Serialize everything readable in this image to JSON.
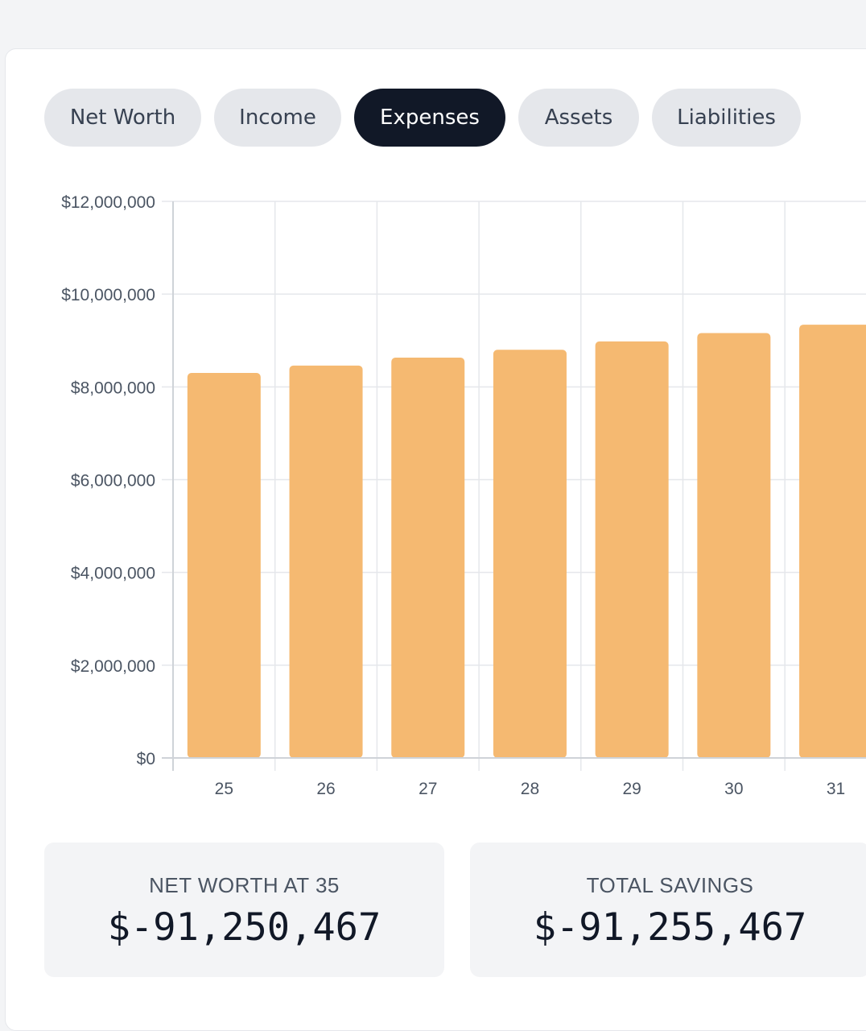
{
  "tabs": [
    {
      "label": "Net Worth",
      "active": false
    },
    {
      "label": "Income",
      "active": false
    },
    {
      "label": "Expenses",
      "active": true
    },
    {
      "label": "Assets",
      "active": false
    },
    {
      "label": "Liabilities",
      "active": false
    }
  ],
  "colors": {
    "bar": "#f5b971",
    "active_tab": "#111827",
    "tab": "#e5e7eb",
    "grid": "#e5e7eb"
  },
  "chart_data": {
    "type": "bar",
    "categories": [
      "25",
      "26",
      "27",
      "28",
      "29",
      "30",
      "31"
    ],
    "values": [
      8300000,
      8460000,
      8630000,
      8800000,
      8980000,
      9160000,
      9340000
    ],
    "ylim": [
      0,
      12000000
    ],
    "y_ticks": [
      0,
      2000000,
      4000000,
      6000000,
      8000000,
      10000000,
      12000000
    ],
    "y_tick_labels": [
      "$0",
      "$2,000,000",
      "$4,000,000",
      "$6,000,000",
      "$8,000,000",
      "$10,000,000",
      "$12,000,000"
    ],
    "grid": true
  },
  "stats": {
    "net_worth": {
      "label": "NET WORTH AT 35",
      "value": "$-91,250,467"
    },
    "total_savings": {
      "label": "TOTAL SAVINGS",
      "value": "$-91,255,467"
    }
  }
}
